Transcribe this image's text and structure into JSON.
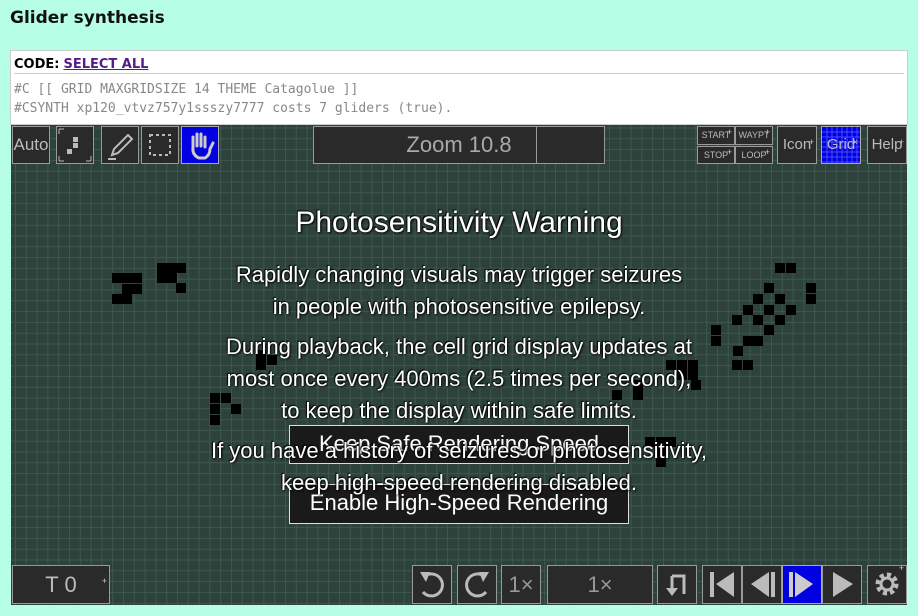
{
  "page": {
    "title": "Glider synthesis"
  },
  "code": {
    "label": "CODE:",
    "select_all": "SELECT ALL",
    "lines": [
      "#C [[ GRID MAXGRIDSIZE 14 THEME Catagolue ]]",
      "#CSYNTH xp120_vtvz757y1ssszy7777 costs 7 gliders (true)."
    ]
  },
  "toolbar": {
    "auto": "Auto",
    "zoom": "Zoom 10.8",
    "start": "START",
    "waypt": "WAYPT",
    "stop": "STOP",
    "loop": "LOOP",
    "icon": "Icon",
    "grid": "Grid",
    "help": "Help"
  },
  "warning": {
    "title": "Photosensitivity Warning",
    "p1": [
      "Rapidly changing visuals may trigger seizures",
      "in people with photosensitive epilepsy."
    ],
    "p2": [
      "During playback, the cell grid display updates at",
      "most once every 400ms (2.5 times per second),",
      "to keep the display within safe limits."
    ],
    "p3": [
      "If you have a history of seizures or photosensitivity,",
      "keep high-speed rendering disabled."
    ],
    "keep_button": "Keep Safe Rendering Speed",
    "enable_button": "Enable High-Speed Rendering"
  },
  "bottom": {
    "gen": "T 0",
    "step": "1×",
    "speed": "1×"
  },
  "colors": {
    "background": "#b6fee6",
    "viewer": "#2e423c",
    "active": "#0000e0"
  }
}
